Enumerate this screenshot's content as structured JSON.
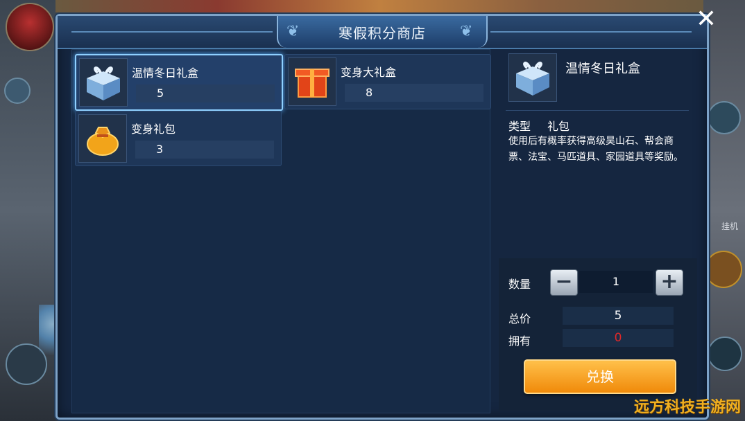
{
  "shop": {
    "title": "寒假积分商店",
    "close_label": "✕"
  },
  "items": [
    {
      "name": "温情冬日礼盒",
      "cost": "5",
      "icon": "blue-gift-box-icon",
      "selected": true
    },
    {
      "name": "变身大礼盒",
      "cost": "8",
      "icon": "red-gift-box-icon",
      "selected": false
    },
    {
      "name": "变身礼包",
      "cost": "3",
      "icon": "gold-bag-icon",
      "selected": false
    }
  ],
  "detail": {
    "name": "温情冬日礼盒",
    "type_label": "类型",
    "type_value": "礼包",
    "description": "使用后有概率获得高级昊山石、帮会商票、法宝、马匹道具、家园道具等奖励。"
  },
  "purchase": {
    "qty_label": "数量",
    "qty_value": "1",
    "minus": "−",
    "plus": "+",
    "total_label": "总价",
    "total_value": "5",
    "own_label": "拥有",
    "own_value": "0",
    "exchange_label": "兑换"
  },
  "hud": {
    "side_text": "挂机"
  },
  "watermark": "远方科技手游网",
  "colors": {
    "panel_bg": "#152640",
    "accent_border": "#7ea3c8",
    "exchange_button": "#f5a623",
    "insufficient": "#e02828"
  }
}
